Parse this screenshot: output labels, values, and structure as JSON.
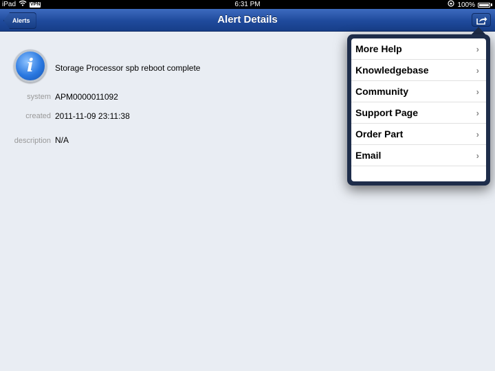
{
  "status_bar": {
    "device": "iPad",
    "vpn": "VPN",
    "time": "6:31 PM",
    "battery": "100%"
  },
  "nav": {
    "title": "Alert Details",
    "back_label": "Alerts",
    "share_icon": "share-icon"
  },
  "alert": {
    "icon": "info-icon",
    "message": "Storage Processor spb reboot complete",
    "fields": [
      {
        "label": "system",
        "value": "APM0000011092"
      },
      {
        "label": "created",
        "value": "2011-11-09 23:11:38"
      },
      {
        "label": "description",
        "value": "N/A"
      }
    ]
  },
  "menu": {
    "items": [
      {
        "label": "More Help"
      },
      {
        "label": "Knowledgebase"
      },
      {
        "label": "Community"
      },
      {
        "label": "Support Page"
      },
      {
        "label": "Order Part"
      },
      {
        "label": "Email"
      }
    ]
  },
  "colors": {
    "nav_bar": "#1f4a9c",
    "background": "#e9edf3",
    "popover_frame": "#1e2d4a"
  }
}
